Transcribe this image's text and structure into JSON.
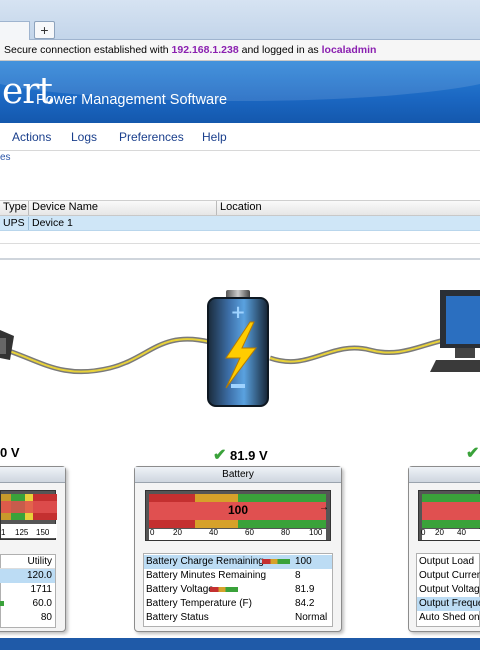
{
  "tabs": {
    "new_tab": "+"
  },
  "status": {
    "prefix": "Secure connection established with",
    "ip": "192.168.1.238",
    "middle": "and logged in as",
    "user": "localadmin"
  },
  "banner": {
    "logo_fragment": "ert",
    "subtitle": "Power Management Software"
  },
  "menu": {
    "items": [
      "Actions",
      "Logs",
      "Preferences",
      "Help"
    ]
  },
  "breadcrumb": "es",
  "device_table": {
    "headers": [
      "Type",
      "Device Name",
      "Location"
    ],
    "rows": [
      {
        "type": "UPS",
        "name": "Device 1",
        "location": ""
      }
    ]
  },
  "readings": {
    "input_voltage": "0 V",
    "battery_voltage": "81.9 V",
    "output_check": "✔"
  },
  "input_panel": {
    "gauge_ticks": [
      "1",
      "125",
      "150"
    ],
    "col_header": "Utility",
    "values": [
      "120.0",
      "1711",
      "60.0",
      "80"
    ],
    "selected_row": 0
  },
  "battery_panel": {
    "title": "Battery",
    "gauge_value": "100",
    "gauge_fill_fraction": 1.0,
    "gauge_ticks": [
      "0",
      "20",
      "40",
      "60",
      "80",
      "100"
    ],
    "rows": [
      {
        "label": "Battery Charge Remaining",
        "value": "100",
        "mini_bar": true,
        "selected": true
      },
      {
        "label": "Battery Minutes Remaining",
        "value": "8",
        "mini_bar": false,
        "selected": false
      },
      {
        "label": "Battery Voltage",
        "value": "81.9",
        "mini_bar": true,
        "selected": false
      },
      {
        "label": "Battery Temperature (F)",
        "value": "84.2",
        "mini_bar": false,
        "selected": false
      },
      {
        "label": "Battery Status",
        "value": "Normal",
        "mini_bar": false,
        "selected": false
      }
    ]
  },
  "output_panel": {
    "gauge_ticks": [
      "0",
      "20",
      "40"
    ],
    "rows": [
      "Output Load",
      "Output Curren",
      "Output Voltag",
      "Output Freque",
      "Auto Shed on"
    ],
    "selected_row": 3
  },
  "colors": {
    "banner": "#1b67c2",
    "link": "#8a1fb0",
    "menu": "#1a3f8c",
    "check": "#3aa23a",
    "selection": "#bcdcf4"
  }
}
